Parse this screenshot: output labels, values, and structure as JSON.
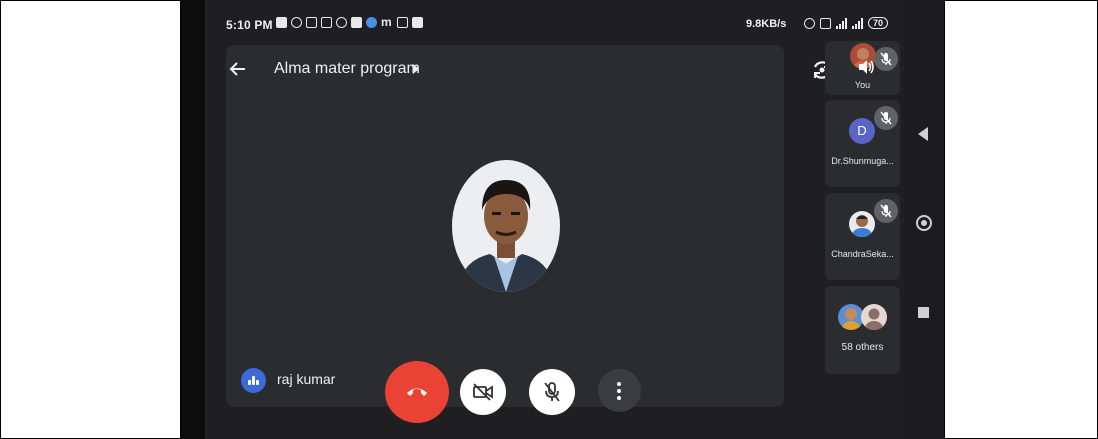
{
  "status_bar": {
    "time": "5:10 PM",
    "network_speed": "9.8KB/s",
    "battery": "70",
    "icons": [
      "notification-icon",
      "whatsapp-icon",
      "calendar-icon",
      "calendar-31-icon",
      "camera-icon",
      "gallery-icon",
      "circle-app-icon",
      "m-app-icon",
      "gmail-icon",
      "photos-icon"
    ]
  },
  "header": {
    "meeting_title": "Alma mater program"
  },
  "participants": [
    {
      "label": "You"
    },
    {
      "label": "Dr.Shunmuga...",
      "initial": "D"
    },
    {
      "label": "ChandraSeka..."
    },
    {
      "label": "58 others"
    }
  ],
  "main": {
    "speaker_name": "raj kumar"
  },
  "colors": {
    "end_call": "#ea4335",
    "avatar_initial": "#5865c4",
    "speaking_badge": "#3b6ad9"
  }
}
